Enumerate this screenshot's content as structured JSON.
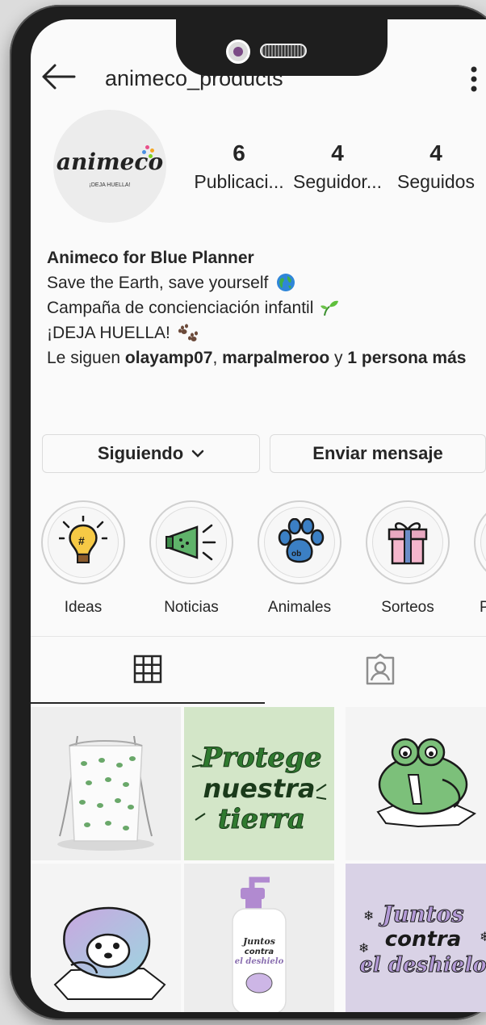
{
  "header": {
    "username": "animeco_products"
  },
  "profile": {
    "avatar_logo": "animeco",
    "avatar_tagline": "¡DEJA HUELLA!",
    "stats": [
      {
        "value": "6",
        "label": "Publicaci..."
      },
      {
        "value": "4",
        "label": "Seguidor..."
      },
      {
        "value": "4",
        "label": "Seguidos"
      }
    ]
  },
  "bio": {
    "name": "Animeco for Blue Planner",
    "line1": "Save the Earth, save yourself",
    "line2": "Campaña de concienciación infantil",
    "line3": "¡DEJA HUELLA!",
    "followed_prefix": "Le siguen",
    "follower1": "olayamp07",
    "follower2": "marpalmeroo",
    "followed_and": "y",
    "followed_more": "1 persona más"
  },
  "buttons": {
    "following": "Siguiendo",
    "message": "Enviar mensaje"
  },
  "highlights": [
    {
      "label": "Ideas",
      "icon": "lightbulb-icon"
    },
    {
      "label": "Noticias",
      "icon": "megaphone-icon"
    },
    {
      "label": "Animales",
      "icon": "paw-icon"
    },
    {
      "label": "Sorteos",
      "icon": "gift-icon"
    },
    {
      "label": "Pr",
      "icon": "partial-highlight-icon"
    }
  ],
  "tabs": [
    {
      "name": "grid",
      "icon": "grid-icon",
      "active": true
    },
    {
      "name": "tagged",
      "icon": "tagged-person-icon",
      "active": false
    }
  ],
  "posts": [
    {
      "kind": "drawstring-bag"
    },
    {
      "kind": "text-poster",
      "lines": [
        "Protege",
        "nuestra",
        "tierra"
      ]
    },
    {
      "kind": "sad-frog"
    },
    {
      "kind": "polar-bear"
    },
    {
      "kind": "soap-bottle",
      "lines": [
        "Juntos",
        "contra",
        "el deshielo"
      ]
    },
    {
      "kind": "text-poster",
      "lines": [
        "Juntos",
        "contra",
        "el deshielo"
      ]
    }
  ],
  "colors": {
    "accent_green": "#2f7a2f",
    "poster_green": "#d3e6c8",
    "lavender": "#d9d2e6"
  }
}
